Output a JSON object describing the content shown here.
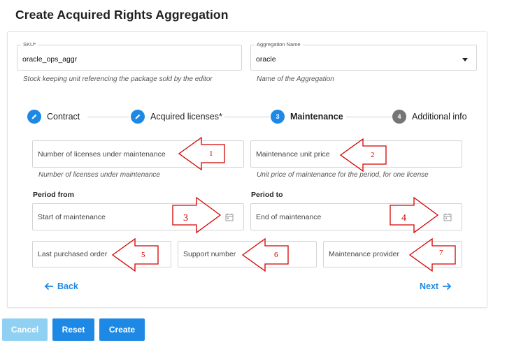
{
  "page": {
    "title": "Create Acquired Rights Aggregation"
  },
  "sku": {
    "label": "SKU*",
    "value": "oracle_ops_aggr",
    "hint": "Stock keeping unit referencing the package sold by the editor"
  },
  "aggregation": {
    "label": "Aggregation Name",
    "value": "oracle",
    "hint": "Name of the Aggregation"
  },
  "stepper": {
    "steps": [
      {
        "label": "Contract",
        "icon": "pencil-icon"
      },
      {
        "label": "Acquired licenses*",
        "icon": "pencil-icon"
      },
      {
        "label": "Maintenance",
        "number": "3"
      },
      {
        "label": "Additional info",
        "number": "4"
      }
    ]
  },
  "maintenance": {
    "licenses": {
      "placeholder": "Number of licenses under maintenance",
      "hint": "Number of licenses under maintenance"
    },
    "unit_price": {
      "placeholder": "Maintenance unit price",
      "hint": "Unit price of maintenance for the period, for one license"
    },
    "period_from": {
      "label": "Period from",
      "placeholder": "Start of maintenance"
    },
    "period_to": {
      "label": "Period to",
      "placeholder": "End of maintenance"
    },
    "last_order": {
      "placeholder": "Last purchased order"
    },
    "support_number": {
      "placeholder": "Support number"
    },
    "provider": {
      "placeholder": "Maintenance provider"
    }
  },
  "nav": {
    "back": "Back",
    "next": "Next"
  },
  "actions": {
    "cancel": "Cancel",
    "reset": "Reset",
    "create": "Create"
  },
  "annotations": [
    "1",
    "2",
    "3",
    "4",
    "5",
    "6",
    "7"
  ],
  "colors": {
    "accent": "#1e88e5",
    "accent_disabled": "#8fd0f3",
    "step_inactive": "#757575",
    "annotation": "#cc0000"
  }
}
